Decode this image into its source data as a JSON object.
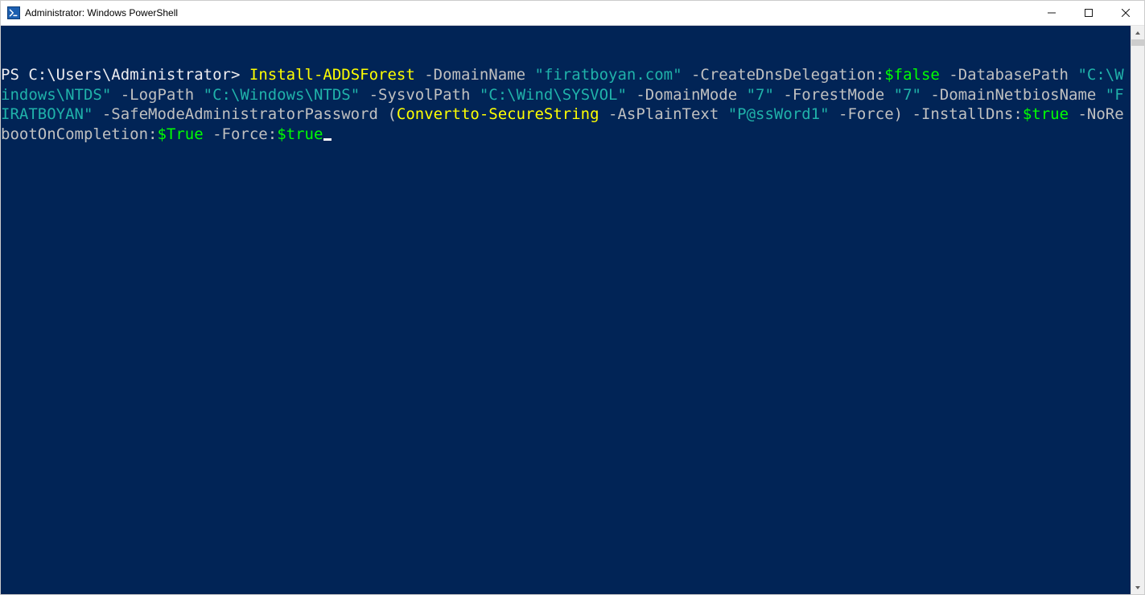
{
  "window": {
    "title": "Administrator: Windows PowerShell"
  },
  "tokens": [
    {
      "cls": "t-prompt",
      "text": "PS C:\\Users\\Administrator"
    },
    {
      "cls": "t-gt",
      "text": "> "
    },
    {
      "cls": "t-cmd",
      "text": "Install-ADDSForest"
    },
    {
      "cls": "t-param",
      "text": " -DomainName "
    },
    {
      "cls": "t-str",
      "text": "\"firatboyan.com\""
    },
    {
      "cls": "t-param",
      "text": " -CreateDnsDelegation:"
    },
    {
      "cls": "t-var",
      "text": "$false"
    },
    {
      "cls": "t-param",
      "text": " -DatabasePath "
    },
    {
      "cls": "t-str",
      "text": "\"C:\\Windows\\NTDS\""
    },
    {
      "cls": "t-param",
      "text": " -LogPath "
    },
    {
      "cls": "t-str",
      "text": "\"C:\\Windows\\NTDS\""
    },
    {
      "cls": "t-param",
      "text": " -SysvolPath "
    },
    {
      "cls": "t-str",
      "text": "\"C:\\Wind\\SYSVOL\""
    },
    {
      "cls": "t-param",
      "text": " -DomainMode "
    },
    {
      "cls": "t-str",
      "text": "\"7\""
    },
    {
      "cls": "t-param",
      "text": " -ForestMode "
    },
    {
      "cls": "t-str",
      "text": "\"7\""
    },
    {
      "cls": "t-param",
      "text": " -DomainNetbiosName "
    },
    {
      "cls": "t-str",
      "text": "\"FIRATBOYAN\""
    },
    {
      "cls": "t-param",
      "text": " -SafeModeAdministratorPassword "
    },
    {
      "cls": "t-punct",
      "text": "("
    },
    {
      "cls": "t-cmd",
      "text": "Convertto-SecureString"
    },
    {
      "cls": "t-param",
      "text": " -AsPlainText "
    },
    {
      "cls": "t-str",
      "text": "\"P@ssWord1\""
    },
    {
      "cls": "t-param",
      "text": " -Force"
    },
    {
      "cls": "t-punct",
      "text": ")"
    },
    {
      "cls": "t-param",
      "text": " -InstallDns:"
    },
    {
      "cls": "t-var",
      "text": "$true"
    },
    {
      "cls": "t-param",
      "text": " -NoRebootOnCompletion:"
    },
    {
      "cls": "t-var",
      "text": "$True"
    },
    {
      "cls": "t-param",
      "text": " -Force:"
    },
    {
      "cls": "t-var",
      "text": "$true"
    }
  ]
}
